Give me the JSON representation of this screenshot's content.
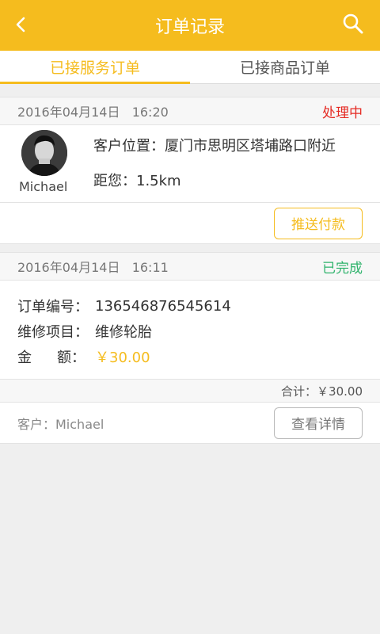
{
  "header": {
    "title": "订单记录",
    "back_icon": "chevron-left-icon",
    "search_icon": "search-icon",
    "color": "#f5bc1e"
  },
  "tabs": [
    {
      "label": "已接服务订单",
      "active": true
    },
    {
      "label": "已接商品订单",
      "active": false
    }
  ],
  "orders": [
    {
      "datetime": "2016年04月14日   16:20",
      "status": "处理中",
      "status_color": "#e52b24",
      "customer_name": "Michael",
      "location_label": "客户位置：",
      "location_value": "厦门市思明区塔埔路口附近",
      "distance_label": "距您：",
      "distance_value": "1.5km",
      "action_label": "推送付款"
    },
    {
      "datetime": "2016年04月14日   16:11",
      "status": "已完成",
      "status_color": "#2fb36c",
      "order_no_label": "订单编号：",
      "order_no_value": "136546876545614",
      "item_label": "维修项目：",
      "item_value": "维修轮胎",
      "amount_label_a": "金",
      "amount_label_b": "额：",
      "amount_value": "￥30.00",
      "total_text": "合计：￥30.00",
      "customer_text": "客户：Michael",
      "action_label": "查看详情"
    }
  ]
}
